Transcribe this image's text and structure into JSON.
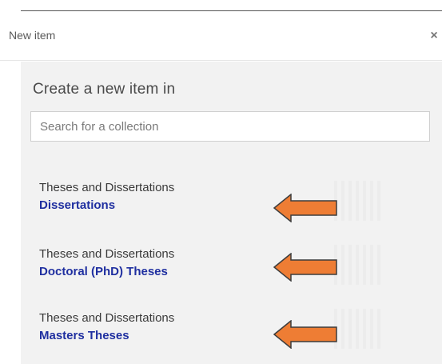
{
  "dialog": {
    "title": "New item",
    "close_symbol": "×"
  },
  "create": {
    "title": "Create a new item in"
  },
  "search": {
    "placeholder": "Search for a collection"
  },
  "collections": [
    {
      "parent": "Theses and Dissertations",
      "name": "Dissertations"
    },
    {
      "parent": "Theses and Dissertations",
      "name": "Doctoral (PhD) Theses"
    },
    {
      "parent": "Theses and Dissertations",
      "name": "Masters Theses"
    }
  ],
  "colors": {
    "link": "#1f2fa0",
    "arrow_fill": "#ee7d34",
    "arrow_stroke": "#3c3c3c",
    "body_background": "#f2f2f2"
  },
  "icons": {
    "close": "close-icon",
    "annotation": "left-arrow-icon"
  }
}
